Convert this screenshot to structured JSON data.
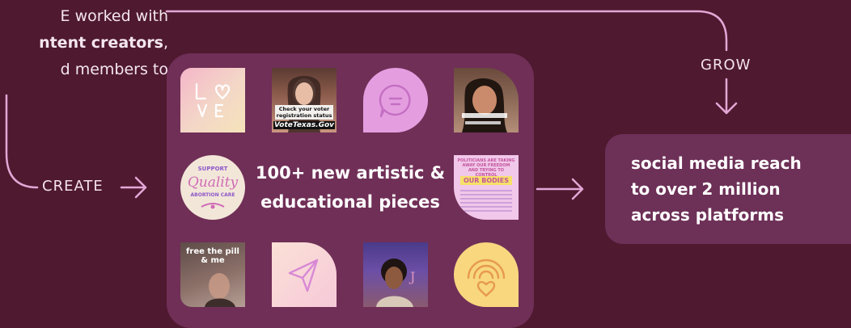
{
  "intro": {
    "line1": "E worked with",
    "line2_bold": "ntent creators",
    "line2_rest": ",",
    "line3": "d members to"
  },
  "flow": {
    "create_label": "CREATE",
    "grow_label": "GROW"
  },
  "center": {
    "line1": "100+ new artistic &",
    "line2": "educational pieces"
  },
  "result": {
    "line1": "social media reach",
    "line2": "to over 2 million",
    "line3": "across platforms"
  },
  "tiles": {
    "vote_caption_1": "Check your voter",
    "vote_caption_2": "registration status",
    "vote_brand": "VoteTexas.Gov",
    "quality_top": "SUPPORT",
    "quality_script": "Quality",
    "quality_bottom": "ABORTION CARE",
    "poster_headline": "POLITICIANS ARE TAKING AWAY OUR FREEDOM AND TRYING TO CONTROL",
    "poster_big": "OUR BODIES",
    "pill_text_1": "free the pill",
    "pill_text_2": "& me",
    "love_letters": "LOVE"
  },
  "colors": {
    "background": "#4f1930",
    "panel": "#702f57",
    "accent_line": "#e3a7d6",
    "tile_lilac": "#e49ee0",
    "tile_yellow": "#f8d77f"
  }
}
